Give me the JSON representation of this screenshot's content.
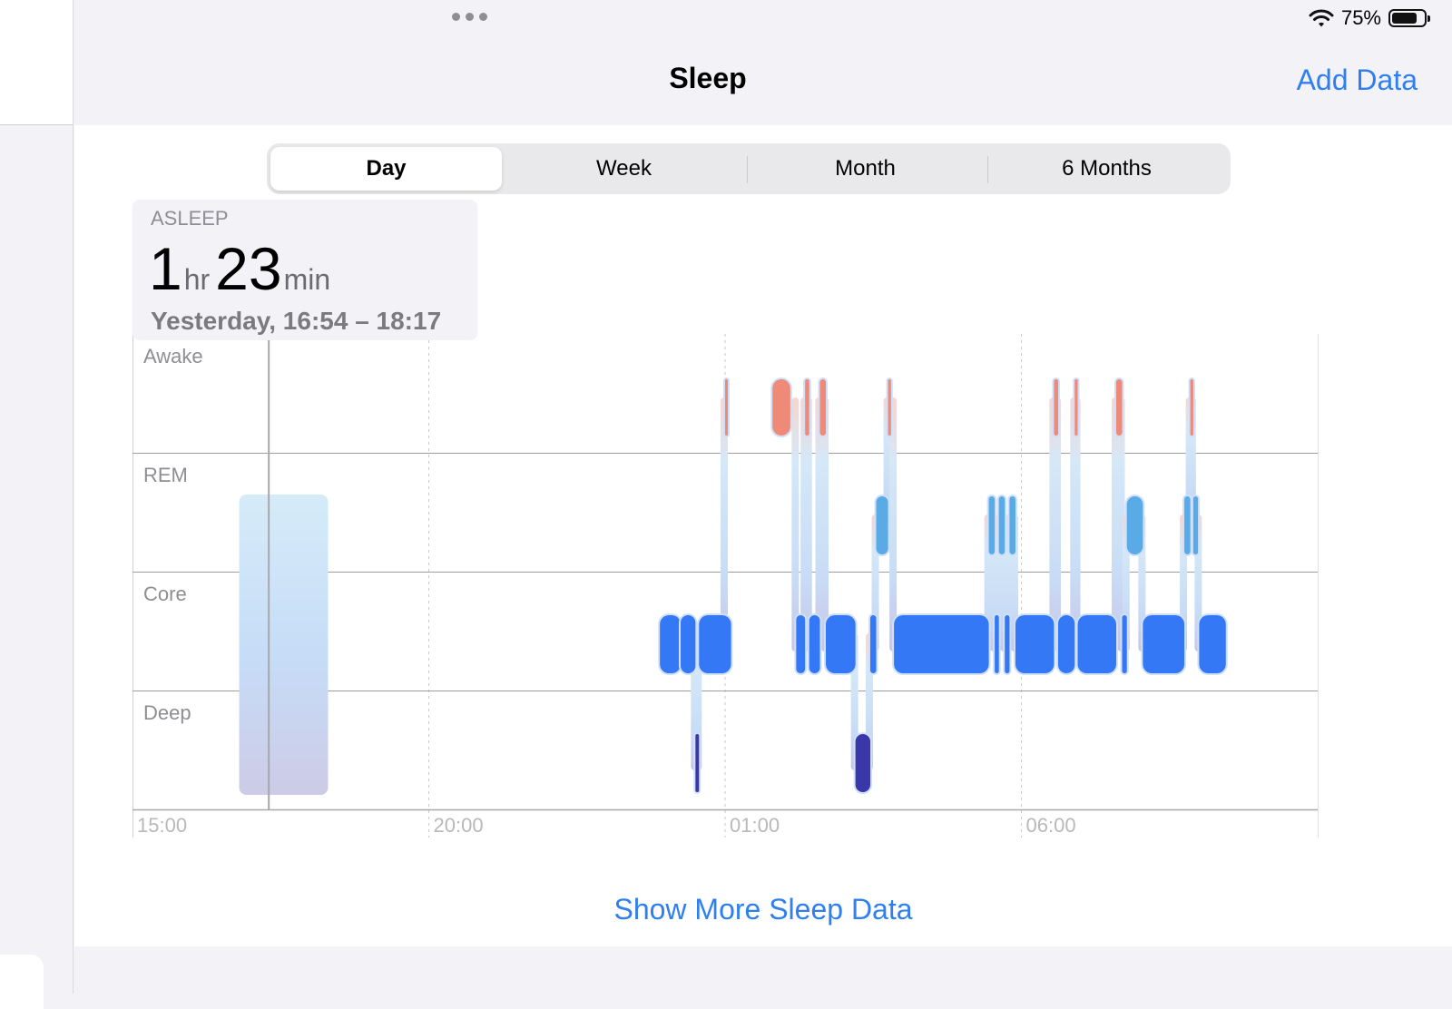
{
  "status": {
    "battery_percent": "75%",
    "battery_level": 0.75
  },
  "nav": {
    "title": "Sleep",
    "add_label": "Add Data"
  },
  "segments": [
    {
      "label": "Day",
      "active": true
    },
    {
      "label": "Week",
      "active": false
    },
    {
      "label": "Month",
      "active": false
    },
    {
      "label": "6 Months",
      "active": false
    }
  ],
  "summary": {
    "label": "ASLEEP",
    "hours": "1",
    "hours_unit": "hr",
    "minutes": "23",
    "minutes_unit": "min",
    "range": "Yesterday, 16:54 – 18:17"
  },
  "footer": {
    "link": "Show More Sleep Data"
  },
  "colors": {
    "awake": "#ef8a78",
    "rem": "#5aaae6",
    "core": "#3478f6",
    "deep": "#3a37a8",
    "accent": "#2f7ff0"
  },
  "chart_data": {
    "type": "timeline",
    "stages": [
      "Awake",
      "REM",
      "Core",
      "Deep"
    ],
    "x_ticks": [
      "15:00",
      "20:00",
      "01:00",
      "06:00"
    ],
    "x_range_hours": [
      15,
      35
    ],
    "selected_time": 17.3,
    "selection_span": [
      16.8,
      18.3
    ],
    "segments": [
      {
        "stage": "Core",
        "start": 23.9,
        "end": 24.25
      },
      {
        "stage": "Core",
        "start": 24.25,
        "end": 24.5
      },
      {
        "stage": "Deep",
        "start": 24.5,
        "end": 24.56
      },
      {
        "stage": "Core",
        "start": 24.56,
        "end": 25.1
      },
      {
        "stage": "Awake",
        "start": 25.0,
        "end": 25.04
      },
      {
        "stage": "Awake",
        "start": 25.8,
        "end": 26.1
      },
      {
        "stage": "Core",
        "start": 26.2,
        "end": 26.35
      },
      {
        "stage": "Awake",
        "start": 26.35,
        "end": 26.42
      },
      {
        "stage": "Core",
        "start": 26.42,
        "end": 26.6
      },
      {
        "stage": "Awake",
        "start": 26.6,
        "end": 26.7
      },
      {
        "stage": "Core",
        "start": 26.7,
        "end": 27.2
      },
      {
        "stage": "Deep",
        "start": 27.2,
        "end": 27.45
      },
      {
        "stage": "Core",
        "start": 27.45,
        "end": 27.55
      },
      {
        "stage": "REM",
        "start": 27.55,
        "end": 27.75
      },
      {
        "stage": "Awake",
        "start": 27.75,
        "end": 27.8
      },
      {
        "stage": "Core",
        "start": 27.85,
        "end": 29.45
      },
      {
        "stage": "REM",
        "start": 29.45,
        "end": 29.55
      },
      {
        "stage": "Core",
        "start": 29.55,
        "end": 29.62
      },
      {
        "stage": "REM",
        "start": 29.62,
        "end": 29.72
      },
      {
        "stage": "Core",
        "start": 29.72,
        "end": 29.8
      },
      {
        "stage": "REM",
        "start": 29.8,
        "end": 29.9
      },
      {
        "stage": "Core",
        "start": 29.9,
        "end": 30.55
      },
      {
        "stage": "Awake",
        "start": 30.55,
        "end": 30.62
      },
      {
        "stage": "Core",
        "start": 30.62,
        "end": 30.9
      },
      {
        "stage": "Awake",
        "start": 30.9,
        "end": 30.95
      },
      {
        "stage": "Core",
        "start": 30.95,
        "end": 31.6
      },
      {
        "stage": "Awake",
        "start": 31.6,
        "end": 31.7
      },
      {
        "stage": "Core",
        "start": 31.7,
        "end": 31.78
      },
      {
        "stage": "REM",
        "start": 31.78,
        "end": 32.05
      },
      {
        "stage": "Core",
        "start": 32.05,
        "end": 32.75
      },
      {
        "stage": "REM",
        "start": 32.75,
        "end": 32.85
      },
      {
        "stage": "Awake",
        "start": 32.85,
        "end": 32.9
      },
      {
        "stage": "REM",
        "start": 32.9,
        "end": 32.98
      },
      {
        "stage": "Core",
        "start": 33.0,
        "end": 33.45
      }
    ]
  }
}
